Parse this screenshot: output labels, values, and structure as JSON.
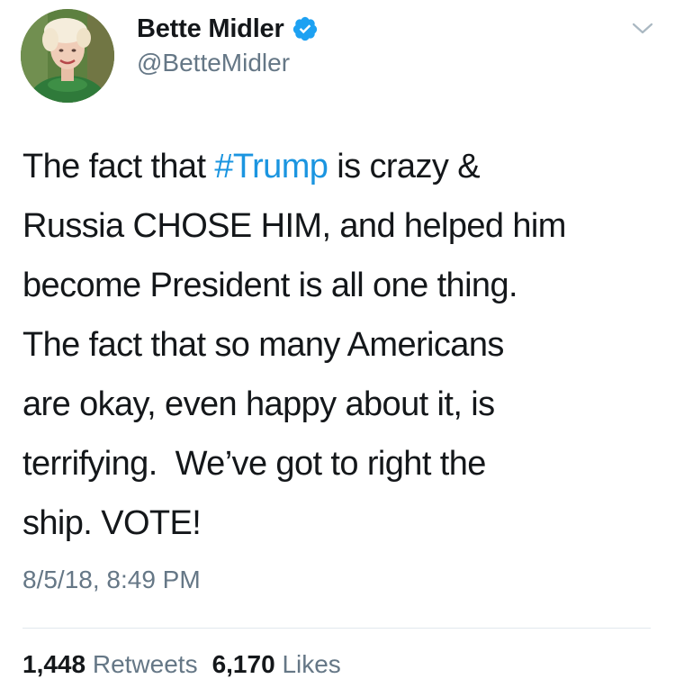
{
  "user": {
    "display_name": "Bette Midler",
    "handle": "@BetteMidler",
    "verified_icon": "verified-badge-icon",
    "avatar_icon": "profile-photo"
  },
  "menu": {
    "icon": "chevron-down-icon"
  },
  "tweet": {
    "lines": [
      {
        "before": "The fact that ",
        "hashtag": "#Trump",
        "after": " is crazy &"
      },
      {
        "text": "Russia CHOSE HIM, and helped him"
      },
      {
        "text": "become President is all one thing."
      },
      {
        "text": "The fact that so many Americans"
      },
      {
        "text": "are okay, even happy about it, is"
      },
      {
        "text": "terrifying.  We’ve got to right the"
      },
      {
        "text": "ship. VOTE!"
      }
    ],
    "timestamp": "8/5/18, 8:49 PM"
  },
  "stats": {
    "retweets_count": "1,448",
    "retweets_label": "Retweets",
    "likes_count": "6,170",
    "likes_label": "Likes"
  },
  "colors": {
    "link": "#1b95e0",
    "secondary_text": "#657786",
    "primary_text": "#14171a",
    "verified": "#1da1f2",
    "divider": "#e1e8ed"
  }
}
